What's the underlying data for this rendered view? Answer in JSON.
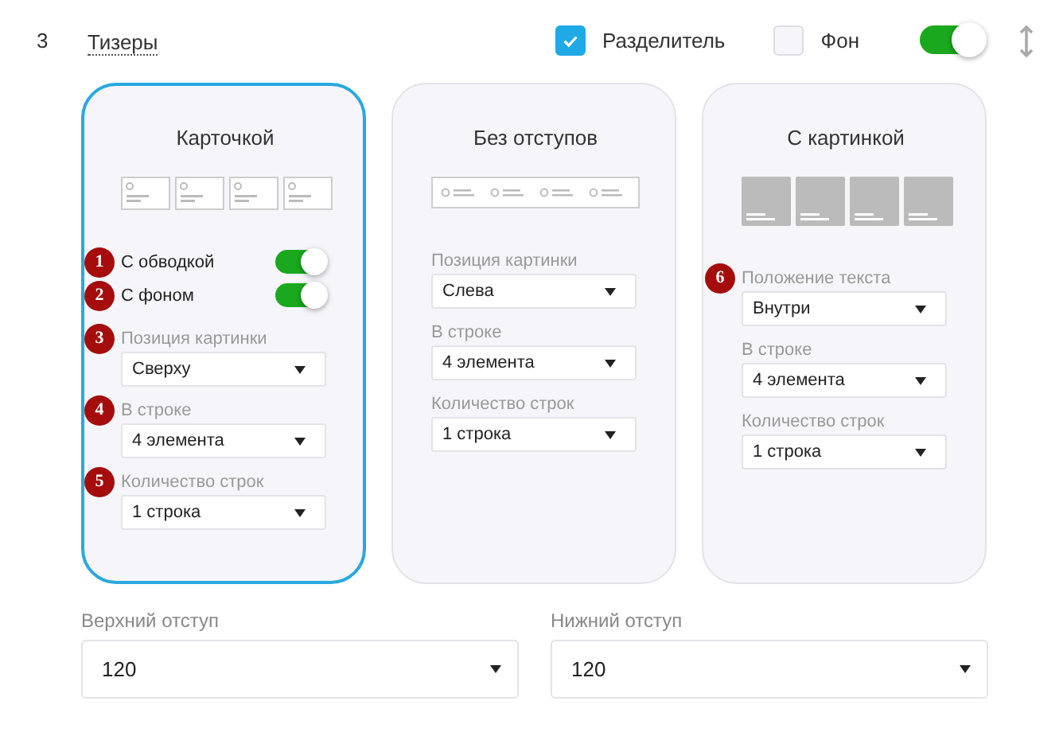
{
  "row": {
    "number": "3",
    "title": "Тизеры",
    "separator": {
      "label": "Разделитель",
      "checked": true
    },
    "background": {
      "label": "Фон",
      "checked": false
    },
    "enabled": true
  },
  "cards": [
    {
      "title": "Карточкой",
      "selected": true,
      "kind": "bordered",
      "toggles": [
        {
          "badge": "1",
          "label": "С обводкой",
          "on": true
        },
        {
          "badge": "2",
          "label": "С фоном",
          "on": true
        }
      ],
      "selects": [
        {
          "badge": "3",
          "label": "Позиция картинки",
          "value": "Сверху"
        },
        {
          "badge": "4",
          "label": "В строке",
          "value": "4 элемента"
        },
        {
          "badge": "5",
          "label": "Количество строк",
          "value": "1 строка"
        }
      ]
    },
    {
      "title": "Без отступов",
      "selected": false,
      "kind": "flat",
      "selects": [
        {
          "label": "Позиция картинки",
          "value": "Слева"
        },
        {
          "label": "В строке",
          "value": "4 элемента"
        },
        {
          "label": "Количество строк",
          "value": "1 строка"
        }
      ]
    },
    {
      "title": "С картинкой",
      "selected": false,
      "kind": "image",
      "selects": [
        {
          "badge": "6",
          "label": "Положение текста",
          "value": "Внутри"
        },
        {
          "label": "В строке",
          "value": "4 элемента"
        },
        {
          "label": "Количество строк",
          "value": "1 строка"
        }
      ]
    }
  ],
  "bottom": [
    {
      "label": "Верхний отступ",
      "value": "120"
    },
    {
      "label": "Нижний отступ",
      "value": "120"
    }
  ]
}
